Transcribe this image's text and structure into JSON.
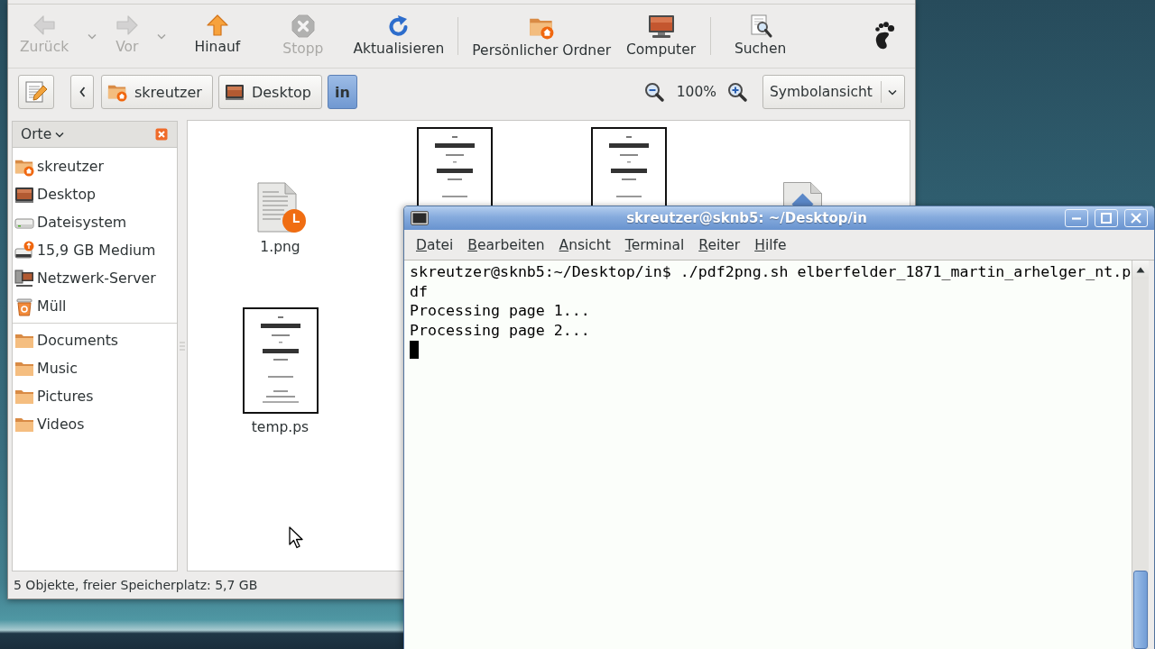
{
  "file_manager": {
    "toolbar": {
      "groups": [
        {
          "buttons": [
            {
              "label": "Zurück",
              "disabled": true,
              "has_menu": true
            },
            {
              "label": "Vor",
              "disabled": true,
              "has_menu": true
            },
            {
              "label": "Hinauf",
              "disabled": false,
              "has_menu": false
            },
            {
              "label": "Stopp",
              "disabled": true,
              "has_menu": false
            },
            {
              "label": "Aktualisieren",
              "disabled": false,
              "has_menu": false
            }
          ]
        },
        {
          "buttons": [
            {
              "label": "Persönlicher Ordner",
              "disabled": false,
              "has_menu": false
            },
            {
              "label": "Computer",
              "disabled": false,
              "has_menu": false
            }
          ]
        },
        {
          "buttons": [
            {
              "label": "Suchen",
              "disabled": false,
              "has_menu": false
            }
          ]
        }
      ]
    },
    "location_bar": {
      "path": [
        {
          "label": "skreutzer",
          "selected": false
        },
        {
          "label": "Desktop",
          "selected": false
        },
        {
          "label": "in",
          "selected": true
        }
      ],
      "zoom": "100%",
      "view": "Symbolansicht"
    },
    "sidebar": {
      "title": "Orte",
      "sections": [
        {
          "items": [
            {
              "label": "skreutzer"
            },
            {
              "label": "Desktop"
            },
            {
              "label": "Dateisystem"
            },
            {
              "label": "15,9 GB Medium"
            },
            {
              "label": "Netzwerk-Server"
            },
            {
              "label": "Müll"
            }
          ]
        },
        {
          "items": [
            {
              "label": "Documents"
            },
            {
              "label": "Music"
            },
            {
              "label": "Pictures"
            },
            {
              "label": "Videos"
            }
          ]
        }
      ]
    },
    "files": [
      {
        "name": "1.png",
        "kind": "document"
      },
      {
        "kind": "thumbnail"
      },
      {
        "kind": "thumbnail"
      },
      {
        "kind": "generic"
      },
      {
        "name": "temp.ps",
        "kind": "thumbnail"
      }
    ],
    "status_bar": "5 Objekte, freier Speicherplatz: 5,7 GB"
  },
  "terminal": {
    "title": "skreutzer@sknb5: ~/Desktop/in",
    "menu": [
      "Datei",
      "Bearbeiten",
      "Ansicht",
      "Terminal",
      "Reiter",
      "Hilfe"
    ],
    "lines": [
      "skreutzer@sknb5:~/Desktop/in$ ./pdf2png.sh elberfelder_1871_martin_arhelger_nt.p",
      "df",
      "Processing page 1...",
      "Processing page 2..."
    ],
    "cursor_visible": true
  }
}
